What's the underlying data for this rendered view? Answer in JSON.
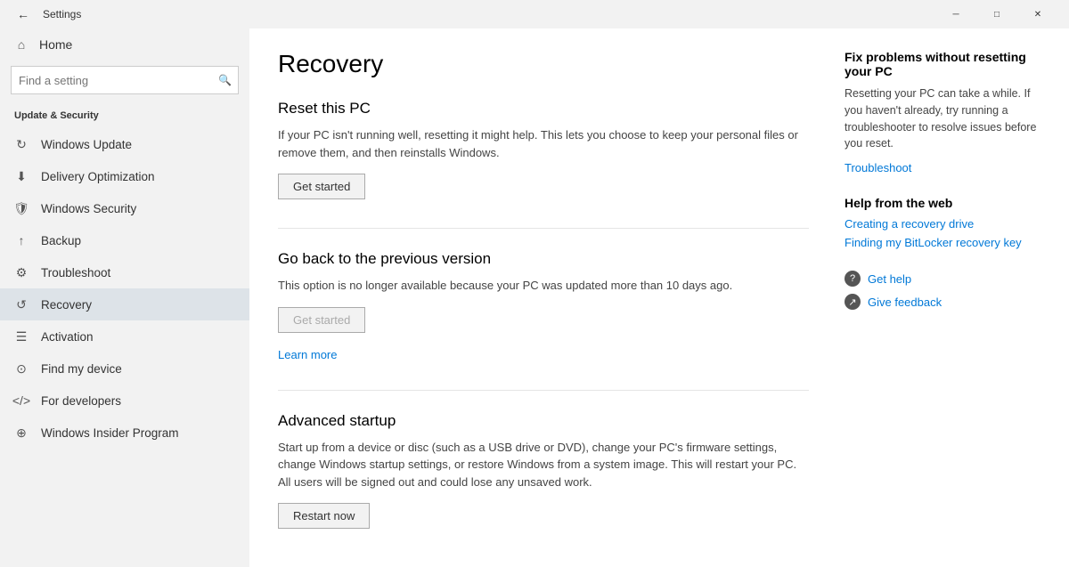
{
  "titlebar": {
    "back_icon": "←",
    "title": "Settings",
    "minimize_icon": "─",
    "maximize_icon": "□",
    "close_icon": "✕"
  },
  "sidebar": {
    "home_label": "Home",
    "search_placeholder": "Find a setting",
    "search_icon": "🔍",
    "section_title": "Update & Security",
    "items": [
      {
        "id": "windows-update",
        "label": "Windows Update",
        "icon": "↻"
      },
      {
        "id": "delivery-optimization",
        "label": "Delivery Optimization",
        "icon": "⬇"
      },
      {
        "id": "windows-security",
        "label": "Windows Security",
        "icon": "🛡"
      },
      {
        "id": "backup",
        "label": "Backup",
        "icon": "↑"
      },
      {
        "id": "troubleshoot",
        "label": "Troubleshoot",
        "icon": "⚙"
      },
      {
        "id": "recovery",
        "label": "Recovery",
        "icon": "↺",
        "active": true
      },
      {
        "id": "activation",
        "label": "Activation",
        "icon": "☰"
      },
      {
        "id": "find-my-device",
        "label": "Find my device",
        "icon": "⊙"
      },
      {
        "id": "for-developers",
        "label": "For developers",
        "icon": "⟨⟩"
      },
      {
        "id": "windows-insider-program",
        "label": "Windows Insider Program",
        "icon": "⊕"
      }
    ]
  },
  "main": {
    "page_title": "Recovery",
    "sections": [
      {
        "id": "reset-pc",
        "title": "Reset this PC",
        "description": "If your PC isn't running well, resetting it might help. This lets you choose to keep your personal files or remove them, and then reinstalls Windows.",
        "button_label": "Get started",
        "button_disabled": false
      },
      {
        "id": "go-back",
        "title": "Go back to the previous version",
        "description": "This option is no longer available because your PC was updated more than 10 days ago.",
        "button_label": "Get started",
        "button_disabled": true,
        "learn_more_label": "Learn more"
      },
      {
        "id": "advanced-startup",
        "title": "Advanced startup",
        "description": "Start up from a device or disc (such as a USB drive or DVD), change your PC's firmware settings, change Windows startup settings, or restore Windows from a system image. This will restart your PC. All users will be signed out and could lose any unsaved work.",
        "button_label": "Restart now",
        "button_disabled": false
      }
    ]
  },
  "right_panel": {
    "fix_section": {
      "title": "Fix problems without resetting your PC",
      "description": "Resetting your PC can take a while. If you haven't already, try running a troubleshooter to resolve issues before you reset.",
      "link_label": "Troubleshoot"
    },
    "help_section": {
      "title": "Help from the web",
      "links": [
        {
          "label": "Creating a recovery drive"
        },
        {
          "label": "Finding my BitLocker recovery key"
        }
      ]
    },
    "bottom_links": [
      {
        "icon": "?",
        "label": "Get help"
      },
      {
        "icon": "↗",
        "label": "Give feedback"
      }
    ]
  }
}
